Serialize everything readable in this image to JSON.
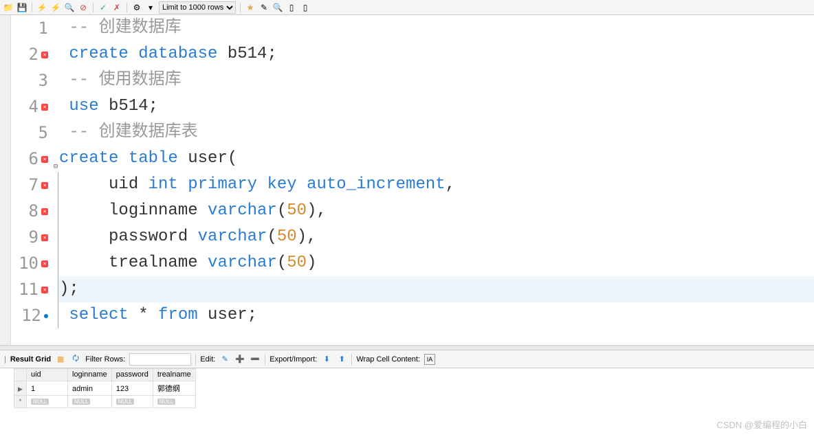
{
  "toolbar": {
    "limit_label": "Limit to 1000 rows"
  },
  "editor": {
    "lines": [
      {
        "num": "1",
        "marker": "",
        "hl": false,
        "tokens": [
          {
            "c": "comment",
            "t": " -- 创建数据库"
          }
        ]
      },
      {
        "num": "2",
        "marker": "x",
        "hl": false,
        "tokens": [
          {
            "c": "keyword",
            "t": " create database "
          },
          {
            "c": "text",
            "t": "b514"
          },
          {
            "c": "text",
            "t": ";"
          }
        ]
      },
      {
        "num": "3",
        "marker": "",
        "hl": false,
        "tokens": [
          {
            "c": "comment",
            "t": " -- 使用数据库"
          }
        ]
      },
      {
        "num": "4",
        "marker": "x",
        "hl": false,
        "tokens": [
          {
            "c": "keyword",
            "t": " use "
          },
          {
            "c": "text",
            "t": "b514"
          },
          {
            "c": "text",
            "t": ";"
          }
        ]
      },
      {
        "num": "5",
        "marker": "",
        "hl": false,
        "tokens": [
          {
            "c": "comment",
            "t": " -- 创建数据库表"
          }
        ]
      },
      {
        "num": "6",
        "marker": "x",
        "hl": false,
        "fold": "⊟",
        "tokens": [
          {
            "c": "keyword",
            "t": "create table "
          },
          {
            "c": "text",
            "t": "user"
          },
          {
            "c": "paren",
            "t": "("
          }
        ]
      },
      {
        "num": "7",
        "marker": "x",
        "hl": false,
        "tokens": [
          {
            "c": "text",
            "t": "     uid "
          },
          {
            "c": "keyword",
            "t": "int primary key auto_increment"
          },
          {
            "c": "text",
            "t": ","
          }
        ]
      },
      {
        "num": "8",
        "marker": "x",
        "hl": false,
        "tokens": [
          {
            "c": "text",
            "t": "     loginname "
          },
          {
            "c": "keyword",
            "t": "varchar"
          },
          {
            "c": "paren",
            "t": "("
          },
          {
            "c": "num",
            "t": "50"
          },
          {
            "c": "paren",
            "t": ")"
          },
          {
            "c": "text",
            "t": ","
          }
        ]
      },
      {
        "num": "9",
        "marker": "x",
        "hl": false,
        "tokens": [
          {
            "c": "text",
            "t": "     password "
          },
          {
            "c": "keyword",
            "t": "varchar"
          },
          {
            "c": "paren",
            "t": "("
          },
          {
            "c": "num",
            "t": "50"
          },
          {
            "c": "paren",
            "t": ")"
          },
          {
            "c": "text",
            "t": ","
          }
        ]
      },
      {
        "num": "10",
        "marker": "x",
        "hl": false,
        "tokens": [
          {
            "c": "text",
            "t": "     trealname "
          },
          {
            "c": "keyword",
            "t": "varchar"
          },
          {
            "c": "paren",
            "t": "("
          },
          {
            "c": "num",
            "t": "50"
          },
          {
            "c": "paren",
            "t": ")"
          }
        ]
      },
      {
        "num": "11",
        "marker": "x",
        "hl": true,
        "tokens": [
          {
            "c": "paren",
            "t": ")"
          },
          {
            "c": "text",
            "t": ";"
          }
        ]
      },
      {
        "num": "12",
        "marker": "dot",
        "hl": false,
        "tokens": [
          {
            "c": "keyword",
            "t": " select "
          },
          {
            "c": "text",
            "t": "* "
          },
          {
            "c": "keyword",
            "t": "from "
          },
          {
            "c": "text",
            "t": "user"
          },
          {
            "c": "text",
            "t": ";"
          }
        ]
      }
    ]
  },
  "result_toolbar": {
    "grid_label": "Result Grid",
    "filter_label": "Filter Rows:",
    "edit_label": "Edit:",
    "export_label": "Export/Import:",
    "wrap_label": "Wrap Cell Content:"
  },
  "grid": {
    "columns": [
      "uid",
      "loginname",
      "password",
      "trealname"
    ],
    "rows": [
      {
        "marker": "▶",
        "cells": [
          "1",
          "admin",
          "123",
          "郭德纲"
        ]
      },
      {
        "marker": "*",
        "cells": [
          "NULL",
          "NULL",
          "NULL",
          "NULL"
        ],
        "null_row": true
      }
    ]
  },
  "watermark": "CSDN @爱编程的小白"
}
